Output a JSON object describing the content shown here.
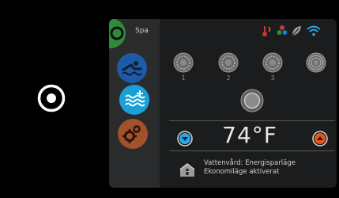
{
  "title": "Spa",
  "jets": [
    {
      "label": "1"
    },
    {
      "label": "2"
    },
    {
      "label": "3"
    },
    {
      "label": ""
    }
  ],
  "temperature": "74°F",
  "message": {
    "line1": "Vattenvård: Energisparläge",
    "line2": "Ekonomiläge aktiverat"
  },
  "colors": {
    "tab_jets": "#1f5aa6",
    "tab_water": "#1aa0d6",
    "tab_settings": "#a0522d",
    "tab_top": "#2e8b3a",
    "arrow_down": "#2aa7e6",
    "arrow_up": "#e6561b",
    "status_red": "#d3332a"
  },
  "icons": {
    "home": "home-target-icon",
    "status": [
      "heater-icon",
      "filter-icon",
      "leaf-icon",
      "wifi-icon"
    ]
  }
}
